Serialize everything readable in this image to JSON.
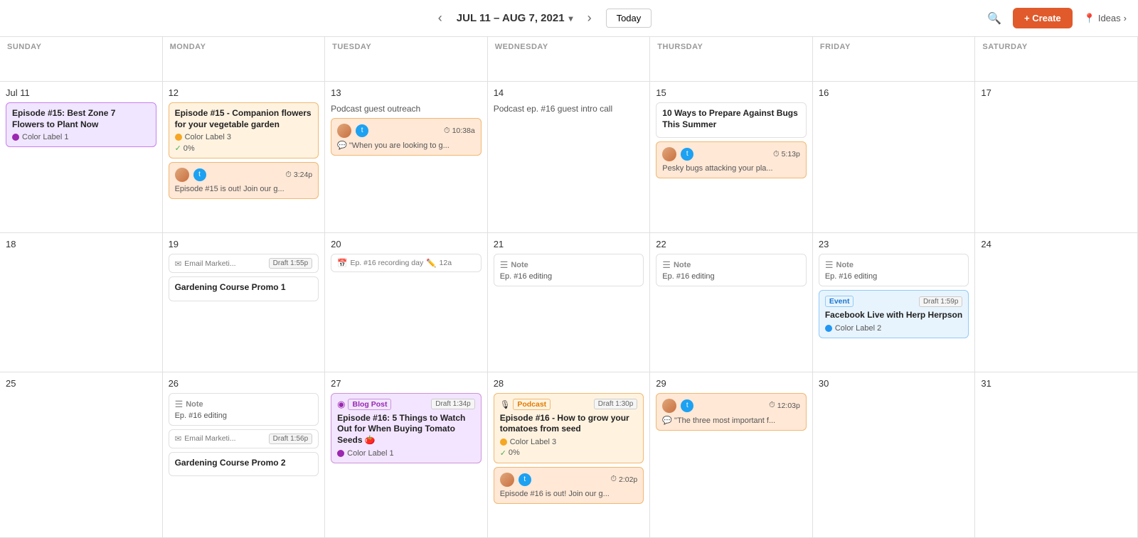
{
  "nav": {
    "prev_label": "‹",
    "next_label": "›",
    "date_range": "JUL 11 – AUG 7, 2021",
    "today_label": "Today",
    "search_icon": "🔍",
    "create_label": "+ Create",
    "ideas_label": "Ideas"
  },
  "day_headers": [
    "SUNDAY",
    "MONDAY",
    "TUESDAY",
    "WEDNESDAY",
    "THURSDAY",
    "FRIDAY",
    "SATURDAY"
  ],
  "weeks": [
    {
      "days": [
        {
          "num": "Jul 11",
          "cards": [
            {
              "type": "purple",
              "title": "Episode #15: Best Zone 7 Flowers to Plant Now",
              "color_label": "Color Label 1",
              "color": "purple"
            }
          ]
        },
        {
          "num": "12",
          "cards": [
            {
              "type": "orange",
              "title": "Episode #15 - Companion flowers for your vegetable garden",
              "color_label": "Color Label 3",
              "color": "orange",
              "pct": "0%"
            },
            {
              "type": "tweet",
              "avatar": true,
              "time": "3:24p",
              "text": "Episode #15 is out! Join our g..."
            }
          ]
        },
        {
          "num": "13",
          "cards": [
            {
              "type": "plain",
              "text": "Podcast guest outreach"
            },
            {
              "type": "tweet",
              "avatar": true,
              "time": "10:38a",
              "text": "\"When you are looking to g..."
            }
          ]
        },
        {
          "num": "14",
          "cards": [
            {
              "type": "plain",
              "text": "Podcast ep. #16 guest intro call"
            }
          ]
        },
        {
          "num": "15",
          "cards": [
            {
              "type": "article",
              "title": "10 Ways to Prepare Against Bugs This Summer"
            },
            {
              "type": "tweet",
              "avatar": true,
              "time": "5:13p",
              "text": "Pesky bugs attacking your pla..."
            }
          ]
        },
        {
          "num": "16",
          "cards": []
        },
        {
          "num": "17",
          "cards": []
        }
      ]
    },
    {
      "days": [
        {
          "num": "18",
          "cards": []
        },
        {
          "num": "19",
          "cards": [
            {
              "type": "email_draft",
              "label": "Email Marketi...",
              "draft": "Draft 1:55p"
            },
            {
              "type": "white",
              "title": "Gardening Course Promo 1"
            }
          ]
        },
        {
          "num": "20",
          "cards": [
            {
              "type": "ep_recording",
              "label": "Ep. #16 recording day",
              "icon": "pencil",
              "time": "12a"
            }
          ]
        },
        {
          "num": "21",
          "cards": [
            {
              "type": "note",
              "title": "Ep. #16 editing"
            }
          ]
        },
        {
          "num": "22",
          "cards": [
            {
              "type": "note",
              "title": "Ep. #16 editing"
            }
          ]
        },
        {
          "num": "23",
          "cards": [
            {
              "type": "note",
              "title": "Ep. #16 editing"
            },
            {
              "type": "event_draft",
              "event_label": "Event",
              "draft": "Draft 1:59p",
              "title": "Facebook Live with Herp Herpson",
              "color_label": "Color Label 2",
              "color": "blue"
            }
          ]
        },
        {
          "num": "24",
          "cards": []
        }
      ]
    },
    {
      "days": [
        {
          "num": "25",
          "cards": []
        },
        {
          "num": "26",
          "cards": [
            {
              "type": "note",
              "title": "Ep. #16 editing"
            },
            {
              "type": "email_draft",
              "label": "Email Marketi...",
              "draft": "Draft 1:56p"
            },
            {
              "type": "white",
              "title": "Gardening Course Promo 2"
            }
          ]
        },
        {
          "num": "27",
          "cards": [
            {
              "type": "blog_draft",
              "blog_label": "Blog Post",
              "draft": "Draft 1:34p",
              "title": "Episode #16: 5 Things to Watch Out for When Buying Tomato Seeds 🍅",
              "color_label": "Color Label 1",
              "color": "purple"
            }
          ]
        },
        {
          "num": "28",
          "cards": [
            {
              "type": "podcast_draft",
              "podcast_label": "Podcast",
              "draft": "Draft 1:30p",
              "title": "Episode #16 - How to grow your tomatoes from seed",
              "color_label": "Color Label 3",
              "color": "orange",
              "pct": "0%"
            },
            {
              "type": "tweet",
              "avatar": true,
              "time": "2:02p",
              "text": "Episode #16 is out! Join our g..."
            }
          ]
        },
        {
          "num": "29",
          "cards": [
            {
              "type": "tweet",
              "avatar": true,
              "time": "12:03p",
              "text": "\"The three most important f..."
            }
          ]
        },
        {
          "num": "30",
          "cards": []
        },
        {
          "num": "31",
          "cards": []
        }
      ]
    }
  ]
}
